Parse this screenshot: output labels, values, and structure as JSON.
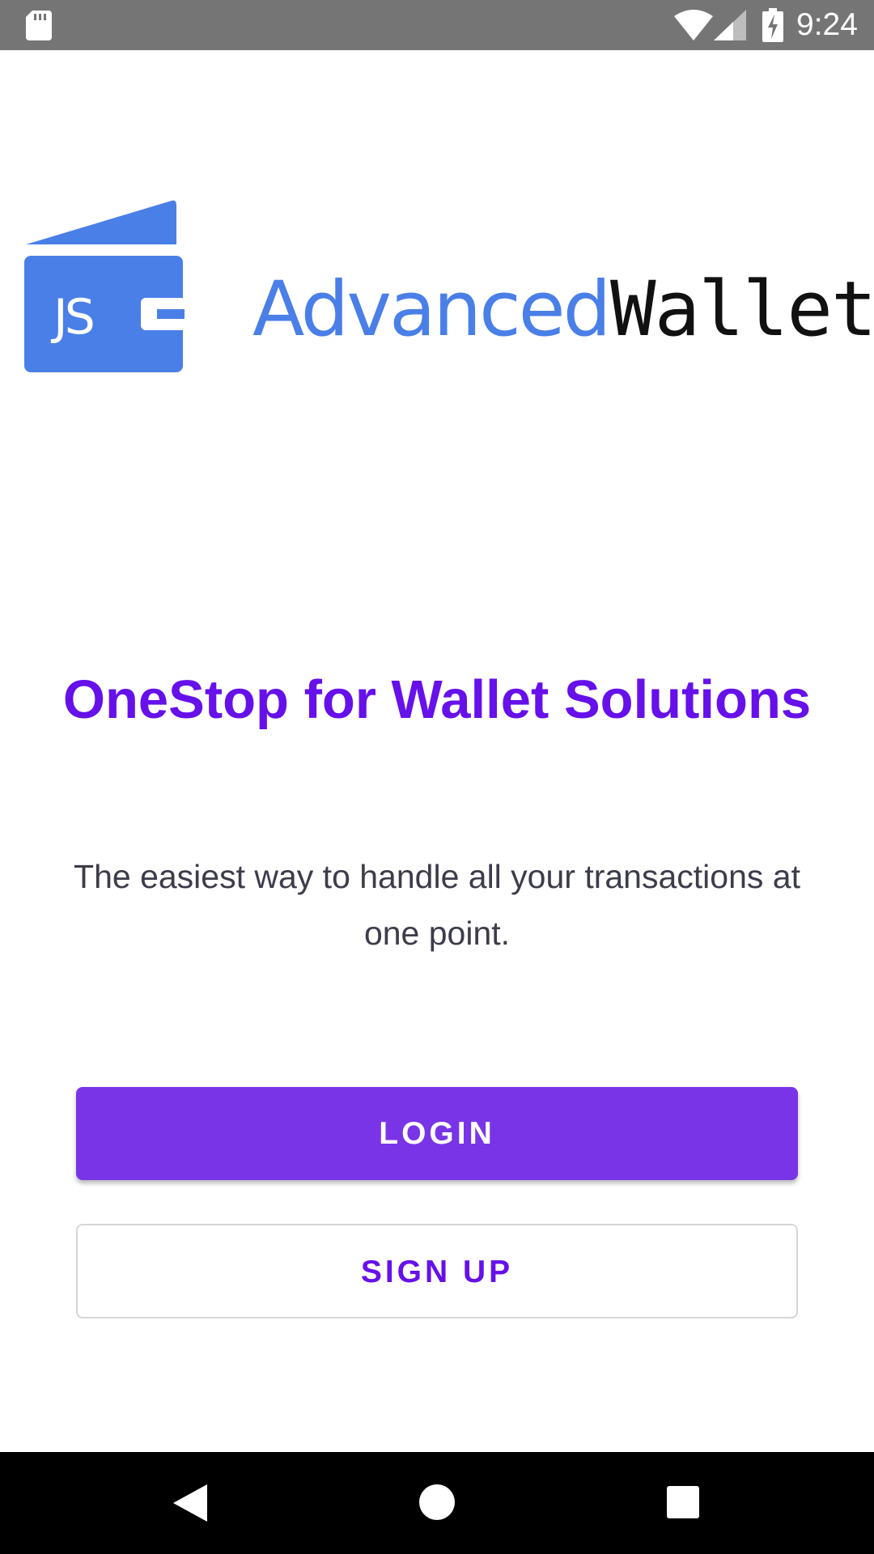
{
  "status_bar": {
    "time": "9:24",
    "icons": [
      "sd-card-icon",
      "wifi-icon",
      "signal-icon",
      "battery-charging-icon"
    ]
  },
  "logo": {
    "icon": "wallet-icon",
    "icon_text": "JS",
    "word_1": "Advanced",
    "word_2": "Wallet",
    "colors": {
      "icon": "#4a7fe8",
      "word_1": "#4a7fe8",
      "word_2": "#111111"
    }
  },
  "headline": "OneStop for Wallet Solutions",
  "description": "The easiest way to handle all your transactions at one point.",
  "buttons": {
    "login_label": "LOGIN",
    "signup_label": "SIGN UP"
  },
  "nav_bar": {
    "icons": [
      "back-icon",
      "home-icon",
      "recents-icon"
    ]
  },
  "colors": {
    "accent": "#6610ea",
    "login_button": "#7934e7",
    "status_bar": "#757575",
    "nav_bar": "#000000"
  }
}
